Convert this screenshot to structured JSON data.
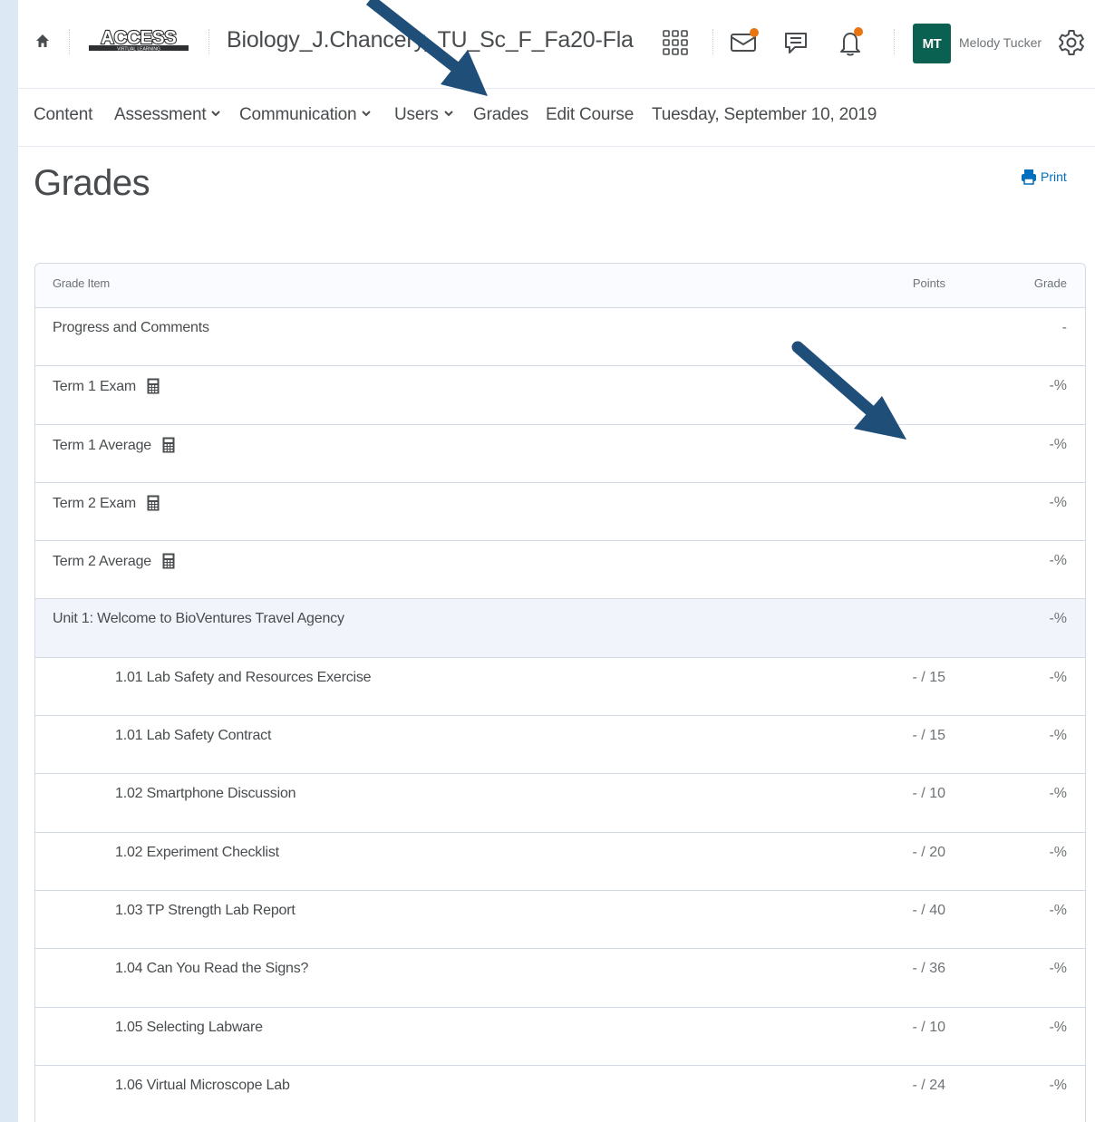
{
  "navbar": {
    "logo_text": "ACCESS",
    "logo_subtext": "VIRTUAL LEARNING",
    "course_title": "Biology_J.Chancery_TU_Sc_F_Fa20-Fla",
    "avatar_initials": "MT",
    "user_name": "Melody Tucker",
    "accent_color": "#0b6151",
    "notification_color": "#e87511"
  },
  "subnav": {
    "items": [
      {
        "label": "Content"
      },
      {
        "label": "Assessment"
      },
      {
        "label": "Communication"
      },
      {
        "label": "Users"
      },
      {
        "label": "Grades"
      },
      {
        "label": "Edit Course"
      },
      {
        "label": "Tuesday, September 10, 2019"
      }
    ]
  },
  "page": {
    "title": "Grades",
    "print_label": "Print"
  },
  "table": {
    "headers": {
      "item": "Grade Item",
      "points": "Points",
      "grade": "Grade"
    },
    "rows": [
      {
        "name": "Progress and Comments",
        "points": "",
        "grade": "-"
      },
      {
        "name": "Term 1 Exam",
        "points": "",
        "grade": "-%"
      },
      {
        "name": "Term 1 Average",
        "points": "",
        "grade": "-%"
      },
      {
        "name": "Term 2 Exam",
        "points": "",
        "grade": "-%"
      },
      {
        "name": "Term 2 Average",
        "points": "",
        "grade": "-%"
      },
      {
        "name": "Unit 1: Welcome to BioVentures Travel Agency",
        "points": "",
        "grade": "-%"
      },
      {
        "name": "1.01 Lab Safety and Resources Exercise",
        "points": "- / 15",
        "grade": "-%"
      },
      {
        "name": "1.01 Lab Safety Contract",
        "points": "- / 15",
        "grade": "-%"
      },
      {
        "name": "1.02 Smartphone Discussion",
        "points": "- / 10",
        "grade": "-%"
      },
      {
        "name": "1.02 Experiment Checklist",
        "points": "- / 20",
        "grade": "-%"
      },
      {
        "name": "1.03 TP Strength Lab Report",
        "points": "- / 40",
        "grade": "-%"
      },
      {
        "name": "1.04 Can You Read the Signs?",
        "points": "- / 36",
        "grade": "-%"
      },
      {
        "name": "1.05 Selecting Labware",
        "points": "- / 10",
        "grade": "-%"
      },
      {
        "name": "1.06 Virtual Microscope Lab",
        "points": "- / 24",
        "grade": "-%"
      }
    ]
  },
  "icons": {
    "home": "home-icon",
    "apps": "apps-grid-icon",
    "mail": "mail-icon",
    "chat": "chat-icon",
    "bell": "bell-icon",
    "gear": "gear-icon",
    "calculator": "calculator-icon",
    "printer": "printer-icon"
  },
  "annotation_color": "#1f4e79"
}
